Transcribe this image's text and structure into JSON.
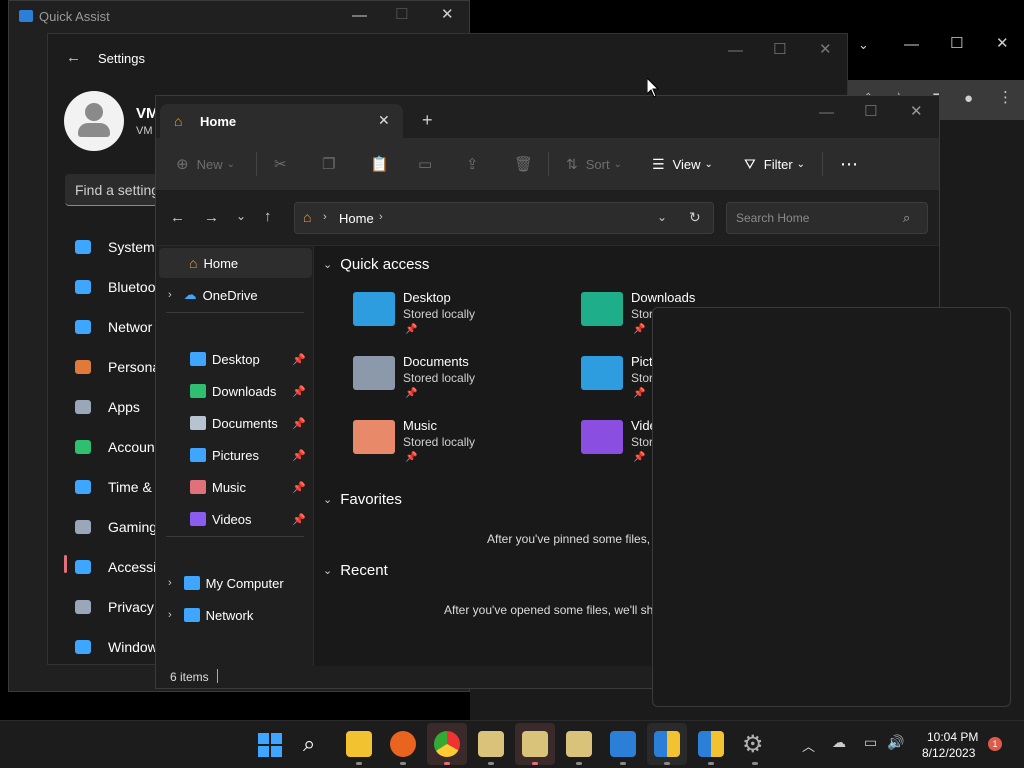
{
  "quick_assist": {
    "title": "Quick Assist"
  },
  "settings": {
    "title": "Settings",
    "user_initials": "VM",
    "user_sub": "VM",
    "search_placeholder": "Find a setting",
    "items": [
      {
        "label": "System",
        "icon": "monitor-icon",
        "color": "#3ea6ff"
      },
      {
        "label": "Bluetoo",
        "icon": "bluetooth-icon",
        "color": "#3ea6ff"
      },
      {
        "label": "Networ",
        "icon": "wifi-icon",
        "color": "#3ea6ff"
      },
      {
        "label": "Persona",
        "icon": "brush-icon",
        "color": "#e07a3a"
      },
      {
        "label": "Apps",
        "icon": "apps-icon",
        "color": "#9aa7b8"
      },
      {
        "label": "Accoun",
        "icon": "account-icon",
        "color": "#2fbf71"
      },
      {
        "label": "Time &",
        "icon": "clock-icon",
        "color": "#3ea6ff"
      },
      {
        "label": "Gaming",
        "icon": "gamepad-icon",
        "color": "#9aa7b8"
      },
      {
        "label": "Accessi",
        "icon": "accessibility-icon",
        "color": "#3ea6ff"
      },
      {
        "label": "Privacy",
        "icon": "shield-icon",
        "color": "#9aa7b8"
      },
      {
        "label": "Window",
        "icon": "update-icon",
        "color": "#3ea6ff"
      }
    ]
  },
  "explorer": {
    "tab_title": "Home",
    "commands": {
      "new": "New",
      "sort": "Sort",
      "view": "View",
      "filter": "Filter"
    },
    "breadcrumb": "Home",
    "search_placeholder": "Search Home",
    "nav": {
      "home": "Home",
      "onedrive": "OneDrive",
      "pinned": [
        {
          "label": "Desktop",
          "color": "#3ea6ff"
        },
        {
          "label": "Downloads",
          "color": "#2fbf71"
        },
        {
          "label": "Documents",
          "color": "#b8c3d1"
        },
        {
          "label": "Pictures",
          "color": "#3ea6ff"
        },
        {
          "label": "Music",
          "color": "#e0707a"
        },
        {
          "label": "Videos",
          "color": "#8a5cf0"
        }
      ],
      "my_computer": "My Computer",
      "network": "Network"
    },
    "quick_access": {
      "heading": "Quick access",
      "items": [
        {
          "name": "Desktop",
          "sub": "Stored locally",
          "color": "#2e9de0"
        },
        {
          "name": "Downloads",
          "sub": "Stor",
          "color": "#1fae8a"
        },
        {
          "name": "Documents",
          "sub": "Stored locally",
          "color": "#8c99ab"
        },
        {
          "name": "Pictu",
          "sub": "Stor",
          "color": "#2e9de0"
        },
        {
          "name": "Music",
          "sub": "Stored locally",
          "color": "#e88a6a"
        },
        {
          "name": "Vide",
          "sub": "Stor",
          "color": "#8a4fe0"
        }
      ]
    },
    "favorites": {
      "heading": "Favorites",
      "message": "After you've pinned some files,"
    },
    "recent": {
      "heading": "Recent",
      "message": "After you've opened some files, we'll sh"
    },
    "status": "6 items"
  },
  "taskbar": {
    "time": "10:04 PM",
    "date": "8/12/2023",
    "notification_count": "1"
  }
}
